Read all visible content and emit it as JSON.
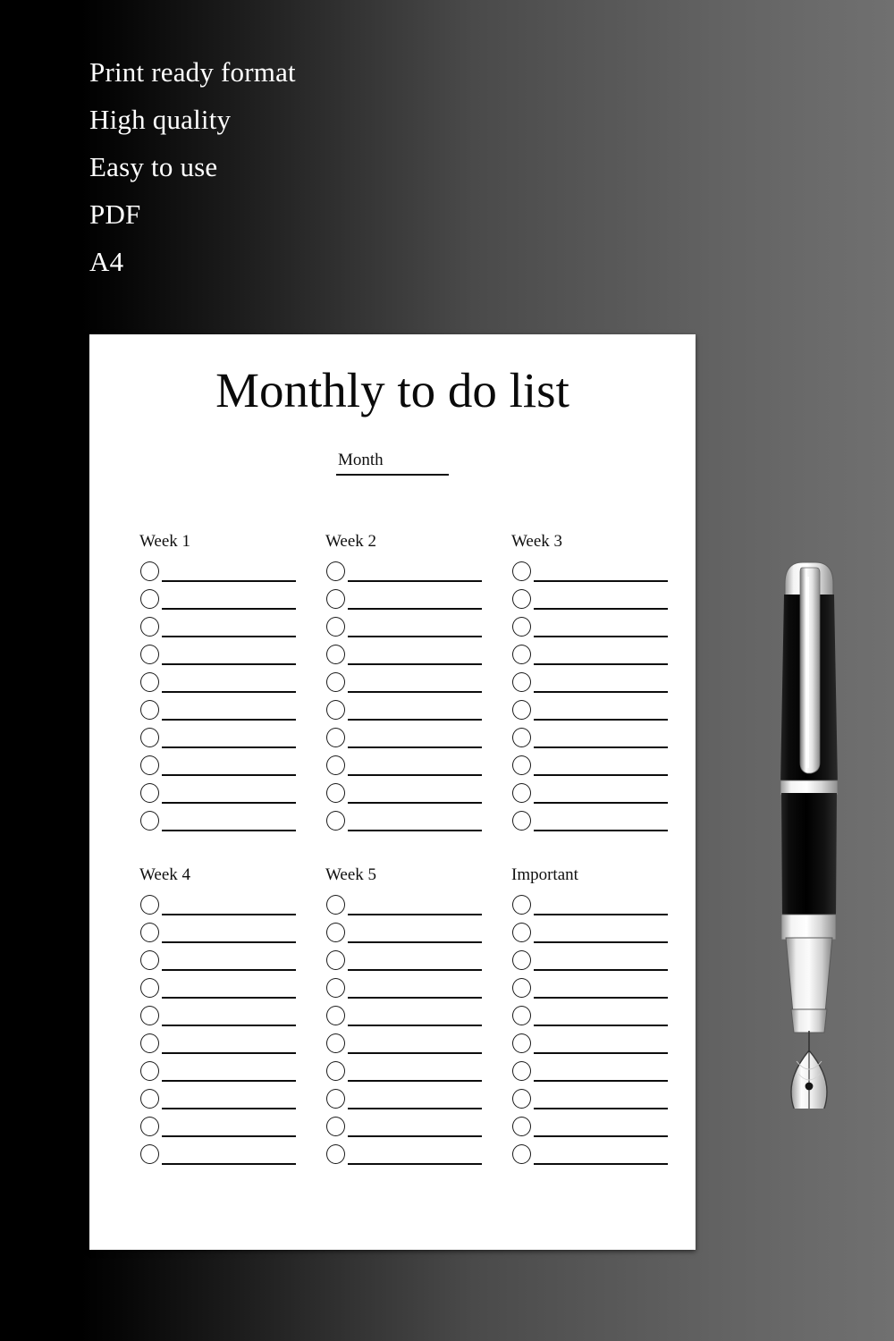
{
  "promo": {
    "features": [
      "Print ready format",
      "High quality",
      "Easy to use",
      "PDF",
      "A4"
    ]
  },
  "document": {
    "title": "Monthly to do list",
    "month_field": {
      "label": "Month",
      "value": ""
    },
    "sections": [
      {
        "heading": "Week 1",
        "rows": 10
      },
      {
        "heading": "Week 2",
        "rows": 10
      },
      {
        "heading": "Week 3",
        "rows": 10
      },
      {
        "heading": "Week 4",
        "rows": 10
      },
      {
        "heading": "Week 5",
        "rows": 10
      },
      {
        "heading": "Important",
        "rows": 10
      }
    ]
  },
  "decor": {
    "pen": "fountain-pen"
  },
  "colors": {
    "page_background": "#ffffff",
    "ink": "#0d0d0d",
    "promo_text": "#ffffff",
    "backdrop_left": "#000000",
    "backdrop_right": "#707070",
    "pen_body": "#111111",
    "pen_chrome": "#e8e8e8"
  }
}
